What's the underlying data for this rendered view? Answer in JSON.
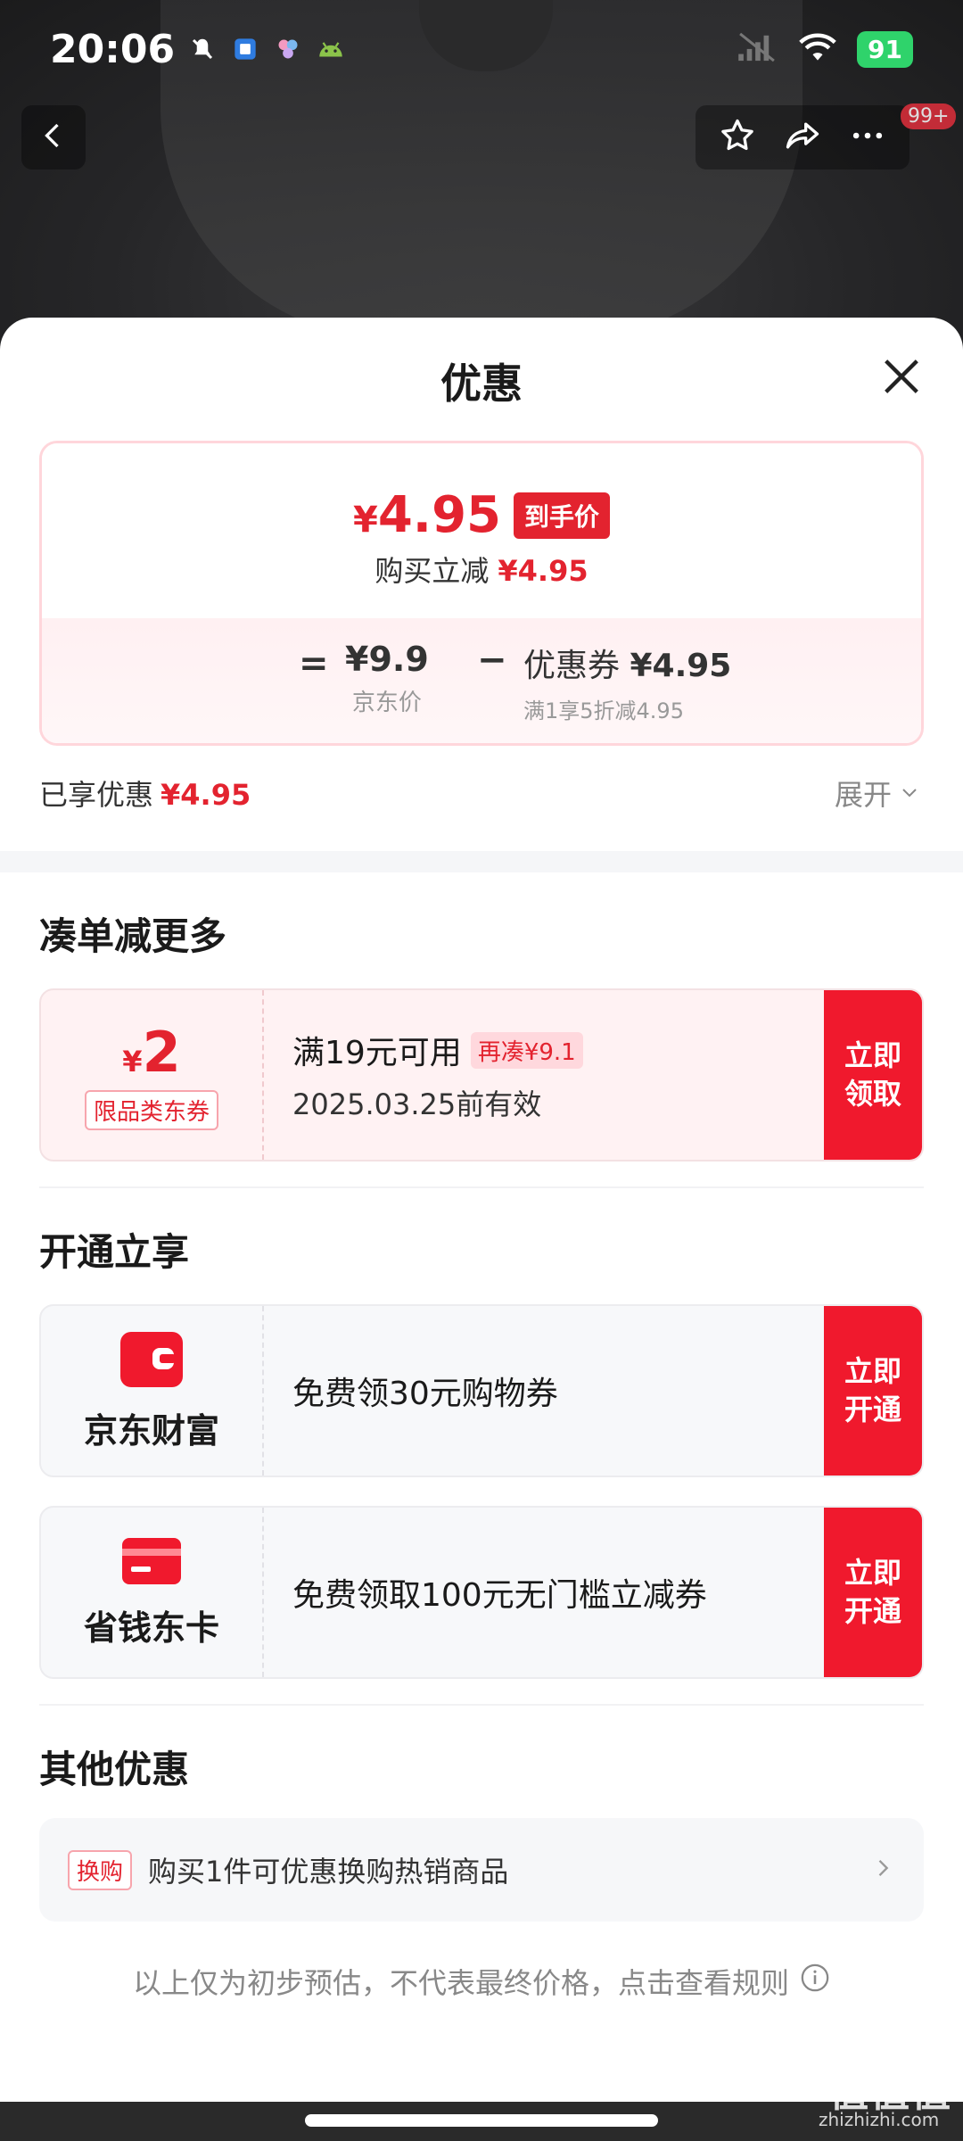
{
  "status_bar": {
    "time": "20:06",
    "battery": "91"
  },
  "top_nav": {
    "notification_badge": "99+"
  },
  "sheet": {
    "title": "优惠",
    "price_card": {
      "final_price_symbol": "¥",
      "final_price": "4.95",
      "final_tag": "到手价",
      "discount_label": "购买立减",
      "discount_value": "¥4.95",
      "equals": "=",
      "jd_price": "¥9.9",
      "jd_price_label": "京东价",
      "minus": "−",
      "coupon_label": "优惠券",
      "coupon_value": "¥4.95",
      "coupon_desc": "满1享5折减4.95"
    },
    "enjoyed": {
      "label": "已享优惠",
      "value": "¥4.95"
    },
    "expand_label": "展开",
    "section_combine": {
      "title": "凑单减更多",
      "coupon": {
        "symbol": "¥",
        "amount": "2",
        "scope": "限品类东券",
        "condition": "满19元可用",
        "more_tag": "再凑¥9.1",
        "validity": "2025.03.25前有效",
        "action": "立即领取"
      }
    },
    "section_open": {
      "title": "开通立享",
      "items": [
        {
          "brand": "京东财富",
          "text": "免费领30元购物券",
          "action": "立即开通"
        },
        {
          "brand": "省钱东卡",
          "text": "免费领取100元无门槛立减券",
          "action": "立即开通"
        }
      ]
    },
    "section_other": {
      "title": "其他优惠",
      "tag": "换购",
      "text": "购买1件可优惠换购热销商品"
    },
    "disclaimer": "以上仅为初步预估，不代表最终价格，点击查看规则"
  },
  "watermark": {
    "logo": "值值值",
    "site": "zhizhizhi.com"
  },
  "colors": {
    "accent_red": "#e3232f",
    "button_red": "#f0192d",
    "battery_green": "#2fd36b"
  },
  "icons": [
    "mute-bell-icon",
    "app-icon",
    "android-icon",
    "signal-icon",
    "wifi-icon",
    "back-icon",
    "star-icon",
    "share-icon",
    "more-icon",
    "close-icon",
    "chevron-down-icon",
    "wallet-icon",
    "card-icon",
    "chevron-right-icon",
    "info-icon"
  ]
}
